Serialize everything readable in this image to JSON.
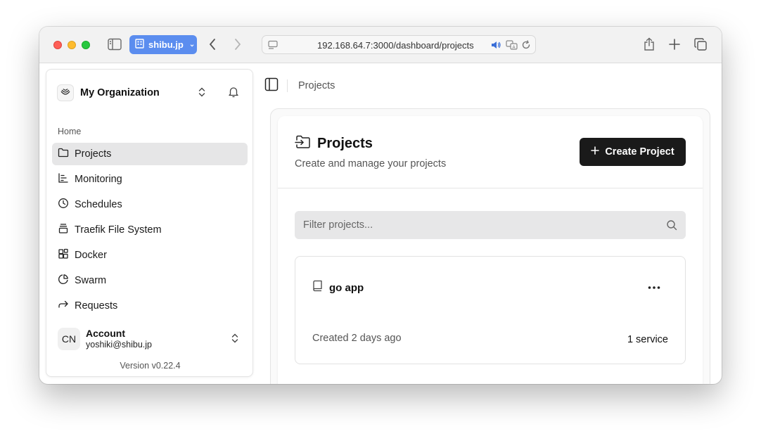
{
  "browser": {
    "tab_label": "shibu.jp",
    "url": "192.168.64.7:3000/dashboard/projects"
  },
  "sidebar": {
    "org_name": "My Organization",
    "section_label": "Home",
    "items": [
      {
        "label": "Projects",
        "icon": "folder-icon",
        "active": true
      },
      {
        "label": "Monitoring",
        "icon": "chart-icon"
      },
      {
        "label": "Schedules",
        "icon": "clock-icon"
      },
      {
        "label": "Traefik File System",
        "icon": "layers-icon"
      },
      {
        "label": "Docker",
        "icon": "blocks-icon"
      },
      {
        "label": "Swarm",
        "icon": "pie-icon"
      },
      {
        "label": "Requests",
        "icon": "arrow-forward-icon"
      }
    ],
    "account": {
      "initials": "CN",
      "name": "Account",
      "email": "yoshiki@shibu.jp"
    },
    "version": "Version v0.22.4"
  },
  "header": {
    "breadcrumb": "Projects"
  },
  "main": {
    "title": "Projects",
    "subtitle": "Create and manage your projects",
    "create_button": "Create Project",
    "filter_placeholder": "Filter projects...",
    "projects": [
      {
        "name": "go app",
        "created": "Created 2 days ago",
        "services": "1 service"
      }
    ]
  },
  "colors": {
    "accent_tab": "#5b8def",
    "button_bg": "#1a1a1a",
    "active_nav_bg": "#e6e6e7"
  }
}
